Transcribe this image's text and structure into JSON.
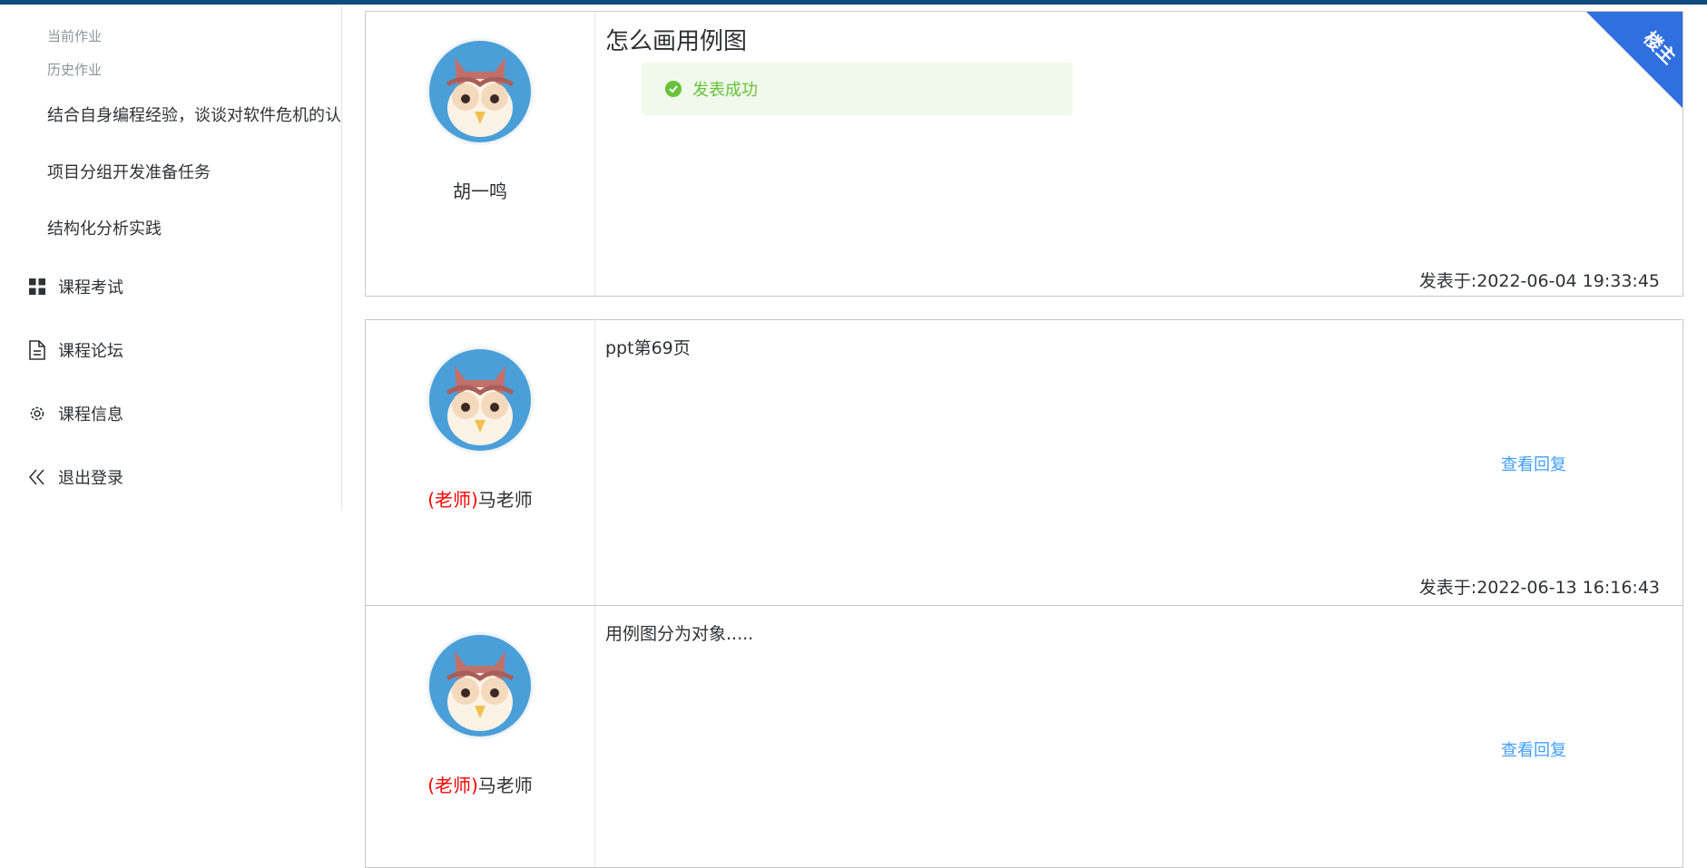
{
  "sidebar": {
    "group_current": "当前作业",
    "group_history": "历史作业",
    "homework_items": [
      {
        "label": "结合自身编程经验，谈谈对软件危机的认识"
      },
      {
        "label": "项目分组开发准备任务"
      },
      {
        "label": "结构化分析实践"
      }
    ],
    "menu": [
      {
        "label": "课程考试",
        "icon": "grid-icon"
      },
      {
        "label": "课程论坛",
        "icon": "document-icon"
      },
      {
        "label": "课程信息",
        "icon": "gear-icon"
      },
      {
        "label": "退出登录",
        "icon": "double-chevron-left-icon"
      }
    ]
  },
  "thread": {
    "title": "怎么画用例图",
    "owner_badge": "楼主",
    "author": "胡一鸣",
    "time": "发表于:2022-06-04 19:33:45",
    "alert": "发表成功"
  },
  "replies": [
    {
      "role": "(老师)",
      "author": "马老师",
      "body": "ppt第69页",
      "view_reply": "查看回复",
      "time": "发表于:2022-06-13 16:16:43"
    },
    {
      "role": "(老师)",
      "author": "马老师",
      "body": "用例图分为对象.....",
      "view_reply": "查看回复"
    }
  ],
  "colors": {
    "link": "#409eff",
    "teacher": "#ff0000",
    "ribbon": "#2f6fde",
    "success": "#67c23a"
  }
}
